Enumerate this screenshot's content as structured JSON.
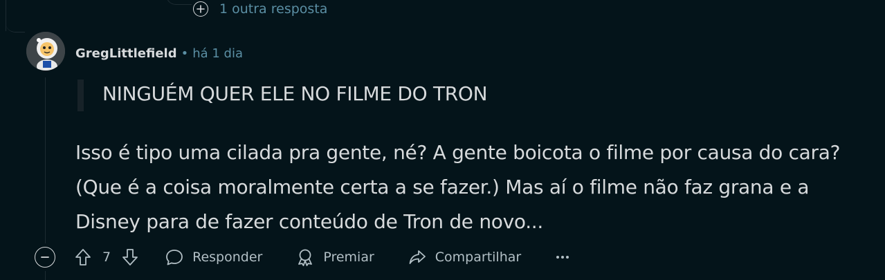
{
  "more_replies": {
    "label": "1 outra resposta",
    "icon": "plus-circle-icon"
  },
  "comment": {
    "author": "GregLittlefield",
    "separator": "•",
    "timestamp": "há 1 dia",
    "quote": "NINGUÉM QUER ELE NO FILME DO TRON",
    "body_lines": [
      "Isso é tipo uma cilada pra gente, né? A gente boicota o filme por causa do cara?",
      "(Que é a coisa moralmente certa a se fazer.) Mas aí o filme não faz grana e a",
      "Disney para de fazer conteúdo de Tron de novo..."
    ]
  },
  "actions": {
    "collapse_icon": "minus-circle-icon",
    "upvote_icon": "arrow-up-icon",
    "vote_count": "7",
    "downvote_icon": "arrow-down-icon",
    "reply_label": "Responder",
    "award_label": "Premiar",
    "share_label": "Compartilhar",
    "more_icon": "ellipsis-icon"
  },
  "colors": {
    "background": "#04141a",
    "text": "#d7dadc",
    "meta": "#5b8fa4"
  }
}
